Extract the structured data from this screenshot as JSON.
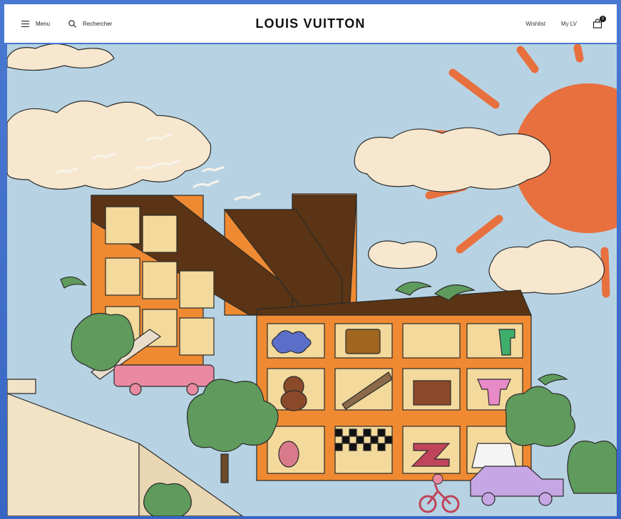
{
  "header": {
    "menu_label": "Menu",
    "search_label": "Rechercher",
    "brand": "LOUIS VUITTON",
    "wishlist_label": "Wishlist",
    "account_label": "My LV",
    "cart_count": "0"
  },
  "hero": {
    "illustration": "lv-monogram-building-illustration"
  },
  "colors": {
    "sky": "#b7d3e3",
    "sun": "#e8703f",
    "building": "#ef8a32",
    "monogram": "#5a3414",
    "cloud": "#f7e7cf",
    "tree": "#5f9b5c"
  }
}
